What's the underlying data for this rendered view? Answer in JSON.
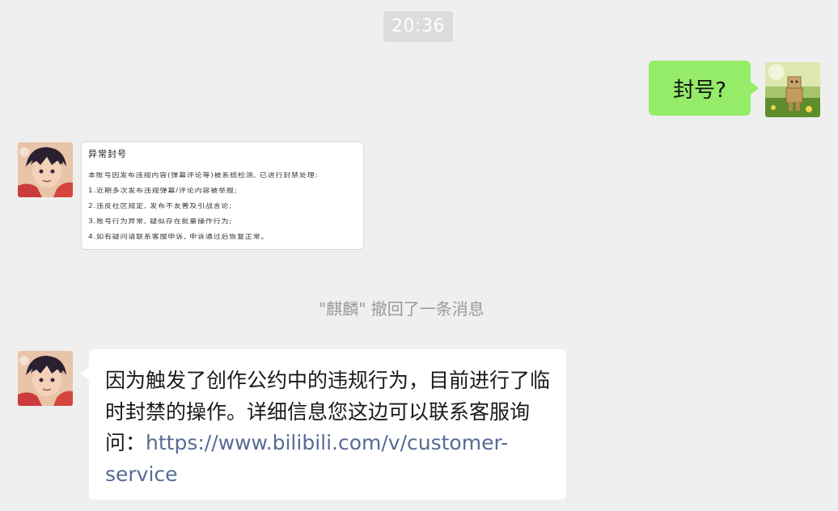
{
  "timestamp": "20:36",
  "messages": {
    "sent": {
      "text": "封号?"
    },
    "received_image": {
      "title": "异常封号",
      "lines": [
        "本账号因发布违规内容(弹幕评论等)被系统检测, 已进行封禁处理:",
        "1.近期多次发布违规弹幕/评论内容被举报;",
        "2.违反社区规定, 发布不友善及引战言论;",
        "3.账号行为异常, 疑似存在批量操作行为;",
        "4.如有疑问请联系客服申诉, 申诉通过后恢复正常。"
      ]
    },
    "recall": {
      "text": "\"麒麟\" 撤回了一条消息"
    },
    "received_text": {
      "body": "因为触发了创作公约中的违规行为，目前进行了临时封禁的操作。详细信息您这边可以联系客服询问：",
      "link": "https://www.bilibili.com/v/customer-service"
    }
  },
  "avatars": {
    "self": "cardboard-robot-avatar",
    "other": "anime-character-avatar"
  },
  "colors": {
    "background": "#efefef",
    "sent_bubble": "#95ec69",
    "received_bubble": "#ffffff",
    "link": "#576b95",
    "system_text": "#9a9a9a",
    "time_badge": "#dcdcdc"
  }
}
